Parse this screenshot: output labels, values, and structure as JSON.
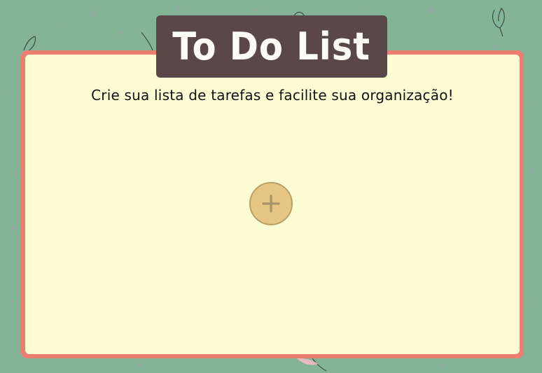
{
  "app": {
    "title": "To Do List",
    "subtitle": "Crie sua lista de tarefas e facilite sua organização!"
  },
  "add_button": {
    "icon": "plus-icon"
  },
  "colors": {
    "background": "#83b496",
    "card_border": "#ee7d72",
    "card_fill": "#fefed5",
    "title_bg": "#5a4849",
    "title_text": "#fdfbf2",
    "add_button_fill": "#e6c683",
    "add_button_border": "#b9a067",
    "plus_icon": "#a89466"
  },
  "decorations": {
    "icons": [
      "leaf-icon",
      "dot-icon"
    ]
  }
}
